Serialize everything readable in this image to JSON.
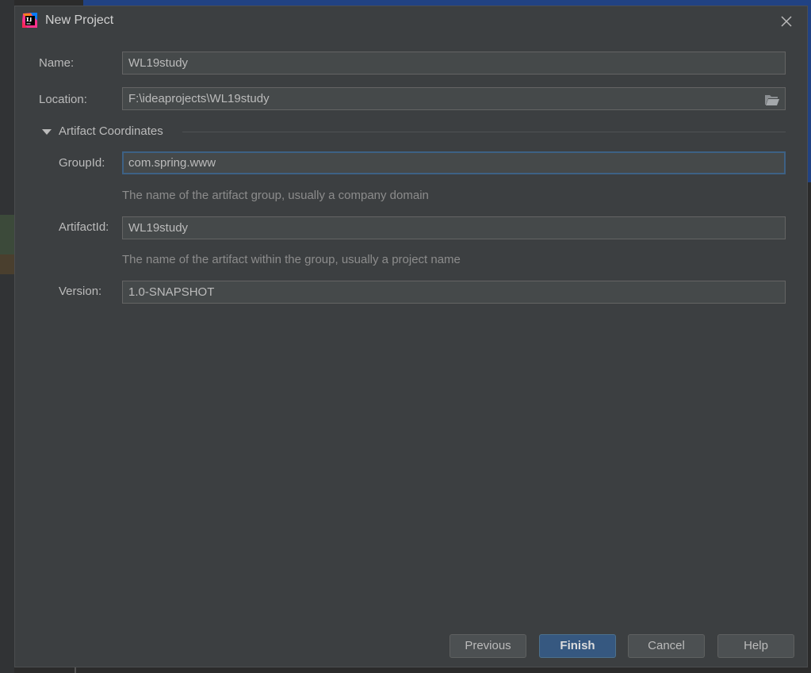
{
  "dialog": {
    "title": "New Project",
    "app_icon": "intellij-idea-icon",
    "close_icon": "close-icon"
  },
  "form": {
    "name_label": "Name:",
    "name_value": "WL19study",
    "location_label": "Location:",
    "location_value": "F:\\ideaprojects\\WL19study",
    "browse_icon": "folder-icon",
    "section_title": "Artifact Coordinates",
    "section_toggle_icon": "triangle-down-icon",
    "groupid_label": "GroupId:",
    "groupid_value": "com.spring.www",
    "groupid_hint": "The name of the artifact group, usually a company domain",
    "artifactid_label": "ArtifactId:",
    "artifactid_value": "WL19study",
    "artifactid_hint": "The name of the artifact within the group, usually a project name",
    "version_label": "Version:",
    "version_value": "1.0-SNAPSHOT"
  },
  "buttons": {
    "previous": "Previous",
    "finish": "Finish",
    "cancel": "Cancel",
    "help": "Help"
  },
  "colors": {
    "dialog_bg": "#3c3f41",
    "field_bg": "#45494a",
    "focus_border": "#3d6185",
    "primary_button": "#365880"
  }
}
